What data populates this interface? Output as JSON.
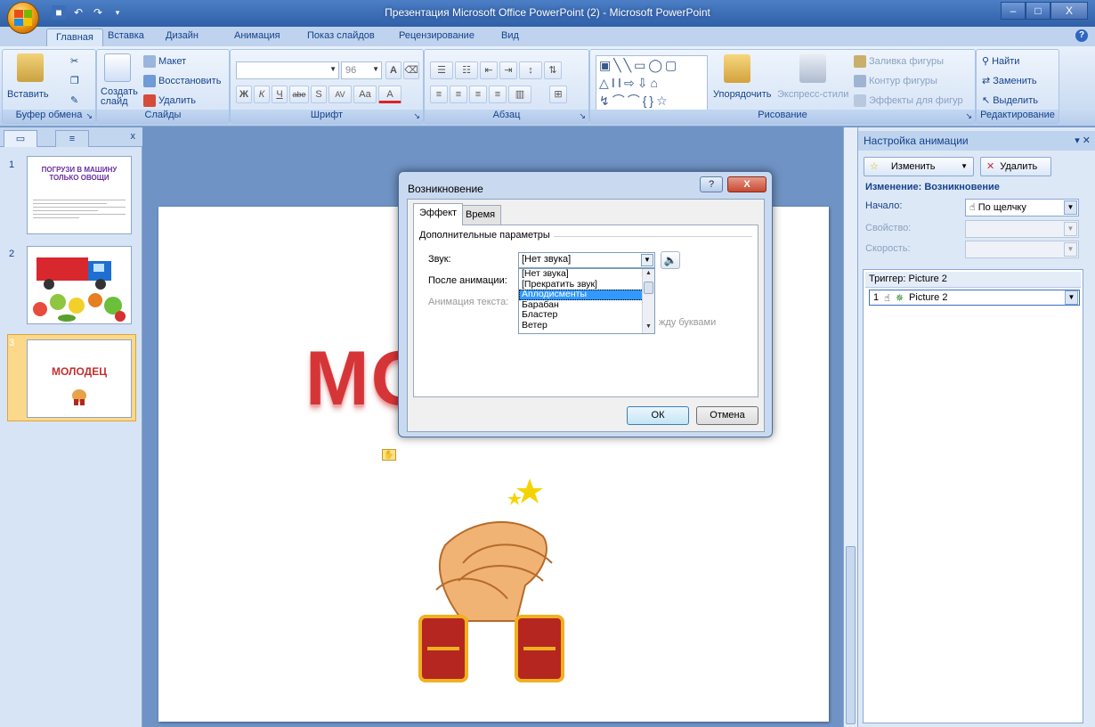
{
  "window": {
    "title": "Презентация Microsoft Office PowerPoint (2) - Microsoft PowerPoint",
    "minimize": "–",
    "maximize": "□",
    "close": "X"
  },
  "ribbon_tabs": [
    "Главная",
    "Вставка",
    "Дизайн",
    "Анимация",
    "Показ слайдов",
    "Рецензирование",
    "Вид"
  ],
  "ribbon": {
    "clipboard": {
      "paste": "Вставить",
      "label": "Буфер обмена"
    },
    "slides": {
      "new_slide": "Создать слайд",
      "layout": "Макет",
      "reset": "Восстановить",
      "delete": "Удалить",
      "label": "Слайды"
    },
    "font": {
      "size": "96",
      "label": "Шрифт",
      "bold": "Ж",
      "italic": "К",
      "underline": "Ч",
      "strike": "abe",
      "shadow": "S",
      "spacing": "AV",
      "case": "Aa",
      "color": "A",
      "grow": "A",
      "shrink": "A"
    },
    "paragraph": {
      "label": "Абзац"
    },
    "drawing": {
      "arrange": "Упорядочить",
      "quick_styles": "Экспресс-стили",
      "fill": "Заливка фигуры",
      "outline": "Контур фигуры",
      "effects": "Эффекты для фигур",
      "label": "Рисование"
    },
    "editing": {
      "find": "Найти",
      "replace": "Заменить",
      "select": "Выделить",
      "label": "Редактирование"
    }
  },
  "slide_pane": {
    "close": "x",
    "slides": [
      {
        "num": "1",
        "title": "ПОГРУЗИ В МАШИНУ ТОЛЬКО ОВОЩИ"
      },
      {
        "num": "2"
      },
      {
        "num": "3",
        "title": "МОЛОДЕЦ"
      }
    ]
  },
  "slide": {
    "heading": "МОЛОДЕЦ"
  },
  "dialog": {
    "title": "Возникновение",
    "help": "?",
    "close": "X",
    "tabs": [
      "Эффект",
      "Время"
    ],
    "group_label": "Дополнительные параметры",
    "sound_label": "Звук:",
    "after_anim_label": "После анимации:",
    "text_anim_label": "Анимация текста:",
    "sound_value": "[Нет звука]",
    "sound_options": [
      "[Нет звука]",
      "[Прекратить звук]",
      "Аплодисменты",
      "Барабан",
      "Бластер",
      "Ветер"
    ],
    "selected_option": "Аплодисменты",
    "partial_text": "жду буквами",
    "ok": "ОК",
    "cancel": "Отмена"
  },
  "task_pane": {
    "title": "Настройка анимации",
    "change_btn": "Изменить",
    "delete_btn": "Удалить",
    "section": "Изменение: Возникновение",
    "start_label": "Начало:",
    "start_value": "По щелчку",
    "property_label": "Свойство:",
    "speed_label": "Скорость:",
    "trigger": "Триггер: Picture 2",
    "item_num": "1",
    "item_name": "Picture 2"
  }
}
